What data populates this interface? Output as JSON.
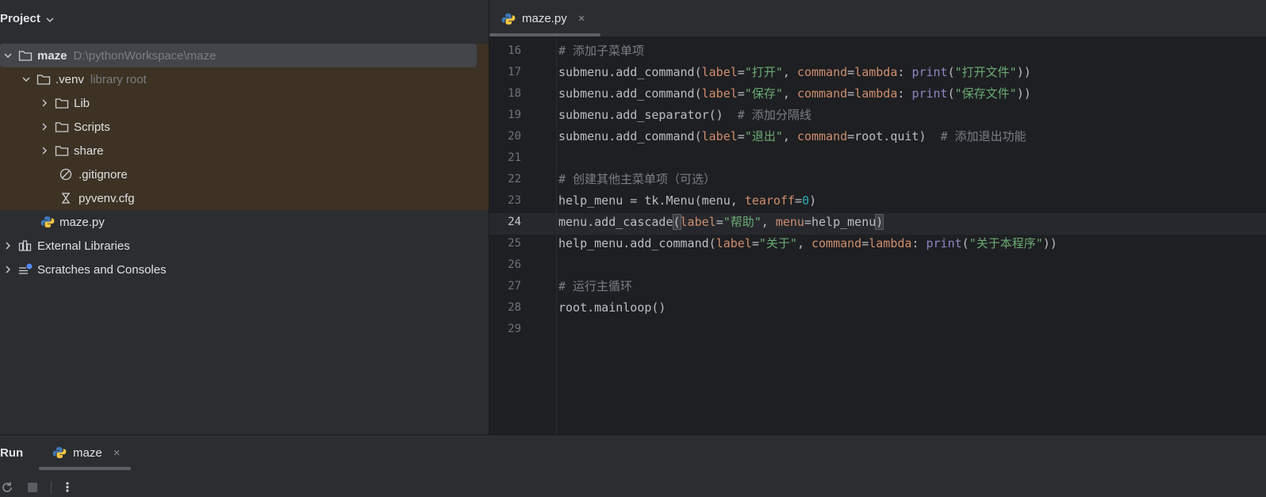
{
  "project_panel": {
    "title": "Project",
    "tree": [
      {
        "name": "maze",
        "hint": "D:\\pythonWorkspace\\maze"
      },
      {
        "name": ".venv",
        "hint": "library root"
      },
      {
        "name": "Lib"
      },
      {
        "name": "Scripts"
      },
      {
        "name": "share"
      },
      {
        "name": ".gitignore"
      },
      {
        "name": "pyvenv.cfg"
      },
      {
        "name": "maze.py"
      },
      {
        "name": "External Libraries"
      },
      {
        "name": "Scratches and Consoles"
      }
    ]
  },
  "editor": {
    "tab": {
      "label": "maze.py",
      "close": "×"
    },
    "line_numbers": [
      "16",
      "17",
      "18",
      "19",
      "20",
      "21",
      "22",
      "23",
      "24",
      "25",
      "26",
      "27",
      "28",
      "29"
    ],
    "current_line": "24",
    "lines": [
      {
        "n": "16",
        "tokens": [
          {
            "t": "# 添加子菜单项",
            "c": "comment"
          }
        ]
      },
      {
        "n": "17",
        "tokens": [
          {
            "t": "submenu.add_command(",
            "c": ""
          },
          {
            "t": "label",
            "c": "kw"
          },
          {
            "t": "=",
            "c": ""
          },
          {
            "t": "\"打开\"",
            "c": "str"
          },
          {
            "t": ", ",
            "c": ""
          },
          {
            "t": "command",
            "c": "kw"
          },
          {
            "t": "=",
            "c": ""
          },
          {
            "t": "lambda",
            "c": "kw"
          },
          {
            "t": ": ",
            "c": ""
          },
          {
            "t": "print",
            "c": "builtin"
          },
          {
            "t": "(",
            "c": ""
          },
          {
            "t": "\"打开文件\"",
            "c": "str"
          },
          {
            "t": "))",
            "c": ""
          }
        ]
      },
      {
        "n": "18",
        "tokens": [
          {
            "t": "submenu.add_command(",
            "c": ""
          },
          {
            "t": "label",
            "c": "kw"
          },
          {
            "t": "=",
            "c": ""
          },
          {
            "t": "\"保存\"",
            "c": "str"
          },
          {
            "t": ", ",
            "c": ""
          },
          {
            "t": "command",
            "c": "kw"
          },
          {
            "t": "=",
            "c": ""
          },
          {
            "t": "lambda",
            "c": "kw"
          },
          {
            "t": ": ",
            "c": ""
          },
          {
            "t": "print",
            "c": "builtin"
          },
          {
            "t": "(",
            "c": ""
          },
          {
            "t": "\"保存文件\"",
            "c": "str"
          },
          {
            "t": "))",
            "c": ""
          }
        ]
      },
      {
        "n": "19",
        "tokens": [
          {
            "t": "submenu.add_separator()  ",
            "c": ""
          },
          {
            "t": "# 添加分隔线",
            "c": "comment"
          }
        ]
      },
      {
        "n": "20",
        "tokens": [
          {
            "t": "submenu.add_command(",
            "c": ""
          },
          {
            "t": "label",
            "c": "kw"
          },
          {
            "t": "=",
            "c": ""
          },
          {
            "t": "\"退出\"",
            "c": "str"
          },
          {
            "t": ", ",
            "c": ""
          },
          {
            "t": "command",
            "c": "kw"
          },
          {
            "t": "=root.quit)  ",
            "c": ""
          },
          {
            "t": "# 添加退出功能",
            "c": "comment"
          }
        ]
      },
      {
        "n": "21",
        "tokens": []
      },
      {
        "n": "22",
        "tokens": [
          {
            "t": "# 创建其他主菜单项（可选）",
            "c": "comment"
          }
        ]
      },
      {
        "n": "23",
        "tokens": [
          {
            "t": "help_menu = tk.Menu(menu, ",
            "c": ""
          },
          {
            "t": "tearoff",
            "c": "kw"
          },
          {
            "t": "=",
            "c": ""
          },
          {
            "t": "0",
            "c": "num"
          },
          {
            "t": ")",
            "c": ""
          }
        ]
      },
      {
        "n": "24",
        "tokens": [
          {
            "t": "menu.add_cascade",
            "c": ""
          },
          {
            "t": "(",
            "c": "paren"
          },
          {
            "t": "label",
            "c": "kw"
          },
          {
            "t": "=",
            "c": ""
          },
          {
            "t": "\"帮助\"",
            "c": "str"
          },
          {
            "t": ", ",
            "c": ""
          },
          {
            "t": "menu",
            "c": "kw"
          },
          {
            "t": "=help_menu",
            "c": ""
          },
          {
            "t": ")",
            "c": "paren"
          }
        ]
      },
      {
        "n": "25",
        "tokens": [
          {
            "t": "help_menu.add_command(",
            "c": ""
          },
          {
            "t": "label",
            "c": "kw"
          },
          {
            "t": "=",
            "c": ""
          },
          {
            "t": "\"关于\"",
            "c": "str"
          },
          {
            "t": ", ",
            "c": ""
          },
          {
            "t": "command",
            "c": "kw"
          },
          {
            "t": "=",
            "c": ""
          },
          {
            "t": "lambda",
            "c": "kw"
          },
          {
            "t": ": ",
            "c": ""
          },
          {
            "t": "print",
            "c": "builtin"
          },
          {
            "t": "(",
            "c": ""
          },
          {
            "t": "\"关于本程序\"",
            "c": "str"
          },
          {
            "t": "))",
            "c": ""
          }
        ]
      },
      {
        "n": "26",
        "tokens": []
      },
      {
        "n": "27",
        "tokens": [
          {
            "t": "# 运行主循环",
            "c": "comment"
          }
        ]
      },
      {
        "n": "28",
        "tokens": [
          {
            "t": "root.mainloop()",
            "c": ""
          }
        ]
      },
      {
        "n": "29",
        "tokens": []
      }
    ]
  },
  "run_panel": {
    "title": "Run",
    "tab": {
      "label": "maze",
      "close": "×"
    },
    "toolbar": {
      "more": "⋮"
    }
  },
  "colors": {
    "background": "#1e1f22",
    "panel": "#2b2d30",
    "highlight_row": "#3d3223",
    "comment": "#7a7e85",
    "string": "#6aab73",
    "keyword": "#cf8e6d",
    "number": "#2aacb8",
    "builtin": "#8888c6"
  }
}
